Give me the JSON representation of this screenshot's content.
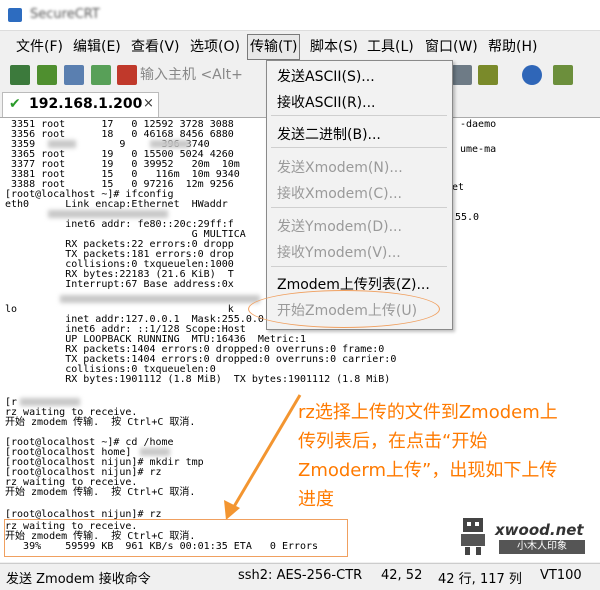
{
  "window": {
    "title": "SecureCRT"
  },
  "menu": {
    "items": [
      "文件(F)",
      "编辑(E)",
      "查看(V)",
      "选项(O)",
      "传输(T)",
      "脚本(S)",
      "工具(L)",
      "窗口(W)",
      "帮助(H)"
    ],
    "active_index": 4
  },
  "toolbar": {
    "address_placeholder": "输入主机 <Alt+"
  },
  "tab": {
    "label": "192.168.1.200",
    "close": "×"
  },
  "dropdown": {
    "items": [
      {
        "label": "发送ASCII(S)...",
        "enabled": true
      },
      {
        "label": "接收ASCII(R)...",
        "enabled": true
      },
      {
        "label": "发送二进制(B)...",
        "enabled": true
      },
      {
        "label": "发送Xmodem(N)...",
        "enabled": false
      },
      {
        "label": "接收Xmodem(C)...",
        "enabled": false
      },
      {
        "label": "发送Ymodem(D)...",
        "enabled": false
      },
      {
        "label": "接收Ymodem(V)...",
        "enabled": false
      },
      {
        "label": "Zmodem上传列表(Z)...",
        "enabled": true
      },
      {
        "label": "开始Zmodem上传(U)",
        "enabled": false
      }
    ]
  },
  "terminal": {
    "lines": [
      " 3351 root      17   0 12592 3728 3088",
      " 3356 root      18   0 46168 8456 6880",
      " 3359              9      396 3740",
      " 3365 root      19   0 15500 5024 4260",
      " 3377 root      19   0 39952   20m  10m",
      " 3381 root      15   0   116m  10m 9340",
      " 3388 root      15   0 97216  12m 9256",
      "[root@localhost ~]# ifconfig",
      "eth0      Link encap:Ethernet  HWaddr",
      "          inet6 addr: fe80::20c:29ff:f",
      "                               G MULTICA",
      "          RX packets:22 errors:0 dropp",
      "          TX packets:181 errors:0 drop",
      "          collisions:0 txqueuelen:1000",
      "          RX bytes:22183 (21.6 KiB)  T",
      "          Interrupt:67 Base address:0x",
      "",
      "",
      "lo                                   k",
      "          inet addr:127.0.0.1  Mask:255.0.0.0",
      "          inet6 addr: ::1/128 Scope:Host",
      "          UP LOOPBACK RUNNING  MTU:16436  Metric:1",
      "          RX packets:1404 errors:0 dropped:0 overruns:0 frame:0",
      "          TX packets:1404 errors:0 dropped:0 overruns:0 carrier:0",
      "          collisions:0 txqueuelen:0",
      "          RX bytes:1901112 (1.8 MiB)  TX bytes:1901112 (1.8 MiB)",
      "",
      "[r",
      "rz waiting to receive.",
      "开始 zmodem 传输.  按 Ctrl+C 取消.",
      "",
      "[root@localhost ~]# cd /home",
      "[root@localhost home]",
      "[root@localhost nijun]# mkdir tmp",
      "[root@localhost nijun]# rz",
      "rz waiting to receive.",
      "开始 zmodem 传输.  按 Ctrl+C 取消.",
      "",
      "[root@localhost nijun]# rz",
      "rz waiting to receive.",
      "开始 zmodem 传输.  按 Ctrl+C 取消.",
      "   39%    59599 KB  961 KB/s 00:01:35 ETA   0 Errors"
    ],
    "right_fragments": [
      "-daemo",
      "ume-ma",
      "et",
      "55.0"
    ]
  },
  "annotation": {
    "lines": [
      "rz选择上传的文件到Zmodem上",
      "传列表后，在点击“开始",
      "Zmoderm上传”，出现如下上传",
      "进度"
    ],
    "color": "#ff7a00"
  },
  "watermark": {
    "site": "xwood.net",
    "label": "小木人印象"
  },
  "status": {
    "message": "发送 Zmodem 接收命令",
    "cipher": "ssh2: AES-256-CTR",
    "cursor": "42,  52",
    "size": "42 行, 117 列",
    "term": "VT100"
  }
}
